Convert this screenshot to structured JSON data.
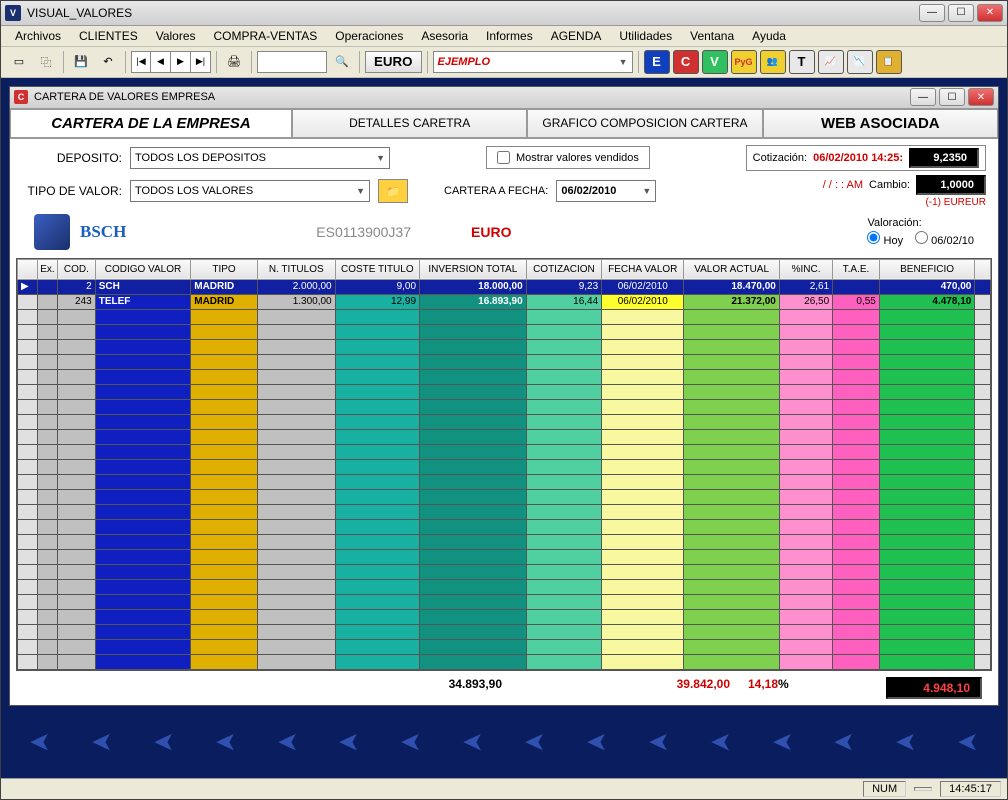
{
  "window": {
    "title": "VISUAL_VALORES"
  },
  "menu": [
    "Archivos",
    "CLIENTES",
    "Valores",
    "COMPRA-VENTAS",
    "Operaciones",
    "Asesoria",
    "Informes",
    "AGENDA",
    "Utilidades",
    "Ventana",
    "Ayuda"
  ],
  "toolbar": {
    "euro_btn": "EURO",
    "ejemplo": "EJEMPLO",
    "logo_btns": [
      {
        "text": "E",
        "bg": "#1040c0",
        "fg": "#fff"
      },
      {
        "text": "C",
        "bg": "#d03030",
        "fg": "#fff"
      },
      {
        "text": "V",
        "bg": "#30c060",
        "fg": "#fff"
      },
      {
        "text": "PyG",
        "bg": "#f0d030",
        "fg": "#d03030"
      },
      {
        "text": "👥",
        "bg": "#f0d030",
        "fg": "#000"
      },
      {
        "text": "T",
        "bg": "#e8e8e8",
        "fg": "#000"
      },
      {
        "text": "📈",
        "bg": "#e8e8e8",
        "fg": "#000"
      },
      {
        "text": "📉",
        "bg": "#e8e8e8",
        "fg": "#000"
      },
      {
        "text": "📋",
        "bg": "#e0b030",
        "fg": "#3040c0"
      }
    ]
  },
  "child": {
    "title": "CARTERA DE VALORES EMPRESA",
    "tabs": {
      "main": "CARTERA DE LA EMPRESA",
      "detalles": "DETALLES CARETRA",
      "grafico": "GRAFICO COMPOSICION CARTERA",
      "web": "WEB ASOCIADA"
    },
    "deposito_label": "DEPOSITO:",
    "deposito_value": "TODOS LOS DEPOSITOS",
    "mostrar_vendidos": "Mostrar valores vendidos",
    "cotizacion_label": "Cotización:",
    "cotizacion_date": "06/02/2010 14:25:",
    "cotizacion_value": "9,2350",
    "tipo_label": "TIPO DE VALOR:",
    "tipo_value": "TODOS LOS VALORES",
    "cartera_fecha_label": "CARTERA A FECHA:",
    "cartera_fecha_value": "06/02/2010",
    "time_sep": "/ /   : :  AM",
    "cambio_label": "Cambio:",
    "cambio_value": "1,0000",
    "cambio_note": "(-1) EUREUR",
    "valoracion_label": "Valoración:",
    "bank_name": "BSCH",
    "isin": "ES0113900J37",
    "euro_label": "EURO",
    "radio_hoy": "Hoy",
    "radio_fecha": "06/02/10"
  },
  "grid": {
    "headers": [
      "Ex.",
      "COD.",
      "CODIGO VALOR",
      "TIPO",
      "N. TITULOS",
      "COSTE TITULO",
      "INVERSION TOTAL",
      "COTIZACION",
      "FECHA VALOR",
      "VALOR ACTUAL",
      "%INC.",
      "T.A.E.",
      "BENEFICIO"
    ],
    "rows": [
      {
        "ex": "",
        "cod": "2",
        "val": "SCH",
        "tipo": "MADRID",
        "ntit": "2.000,00",
        "cost": "9,00",
        "inv": "18.000,00",
        "cot": "9,23",
        "fec": "06/02/2010",
        "act": "18.470,00",
        "inc": "2,61",
        "tae": "",
        "ben": "470,00"
      },
      {
        "ex": "",
        "cod": "243",
        "val": "TELEF",
        "tipo": "MADRID",
        "ntit": "1.300,00",
        "cost": "12,99",
        "inv": "16.893,90",
        "cot": "16,44",
        "fec": "06/02/2010",
        "act": "21.372,00",
        "inc": "26,50",
        "tae": "0,55",
        "ben": "4.478,10"
      }
    ],
    "totals": {
      "inv": "34.893,90",
      "act": "39.842,00",
      "inc": "14,18",
      "pct": "%",
      "ben": "4.948,10"
    }
  },
  "statusbar": {
    "num": "NUM",
    "time": "14:45:17"
  }
}
